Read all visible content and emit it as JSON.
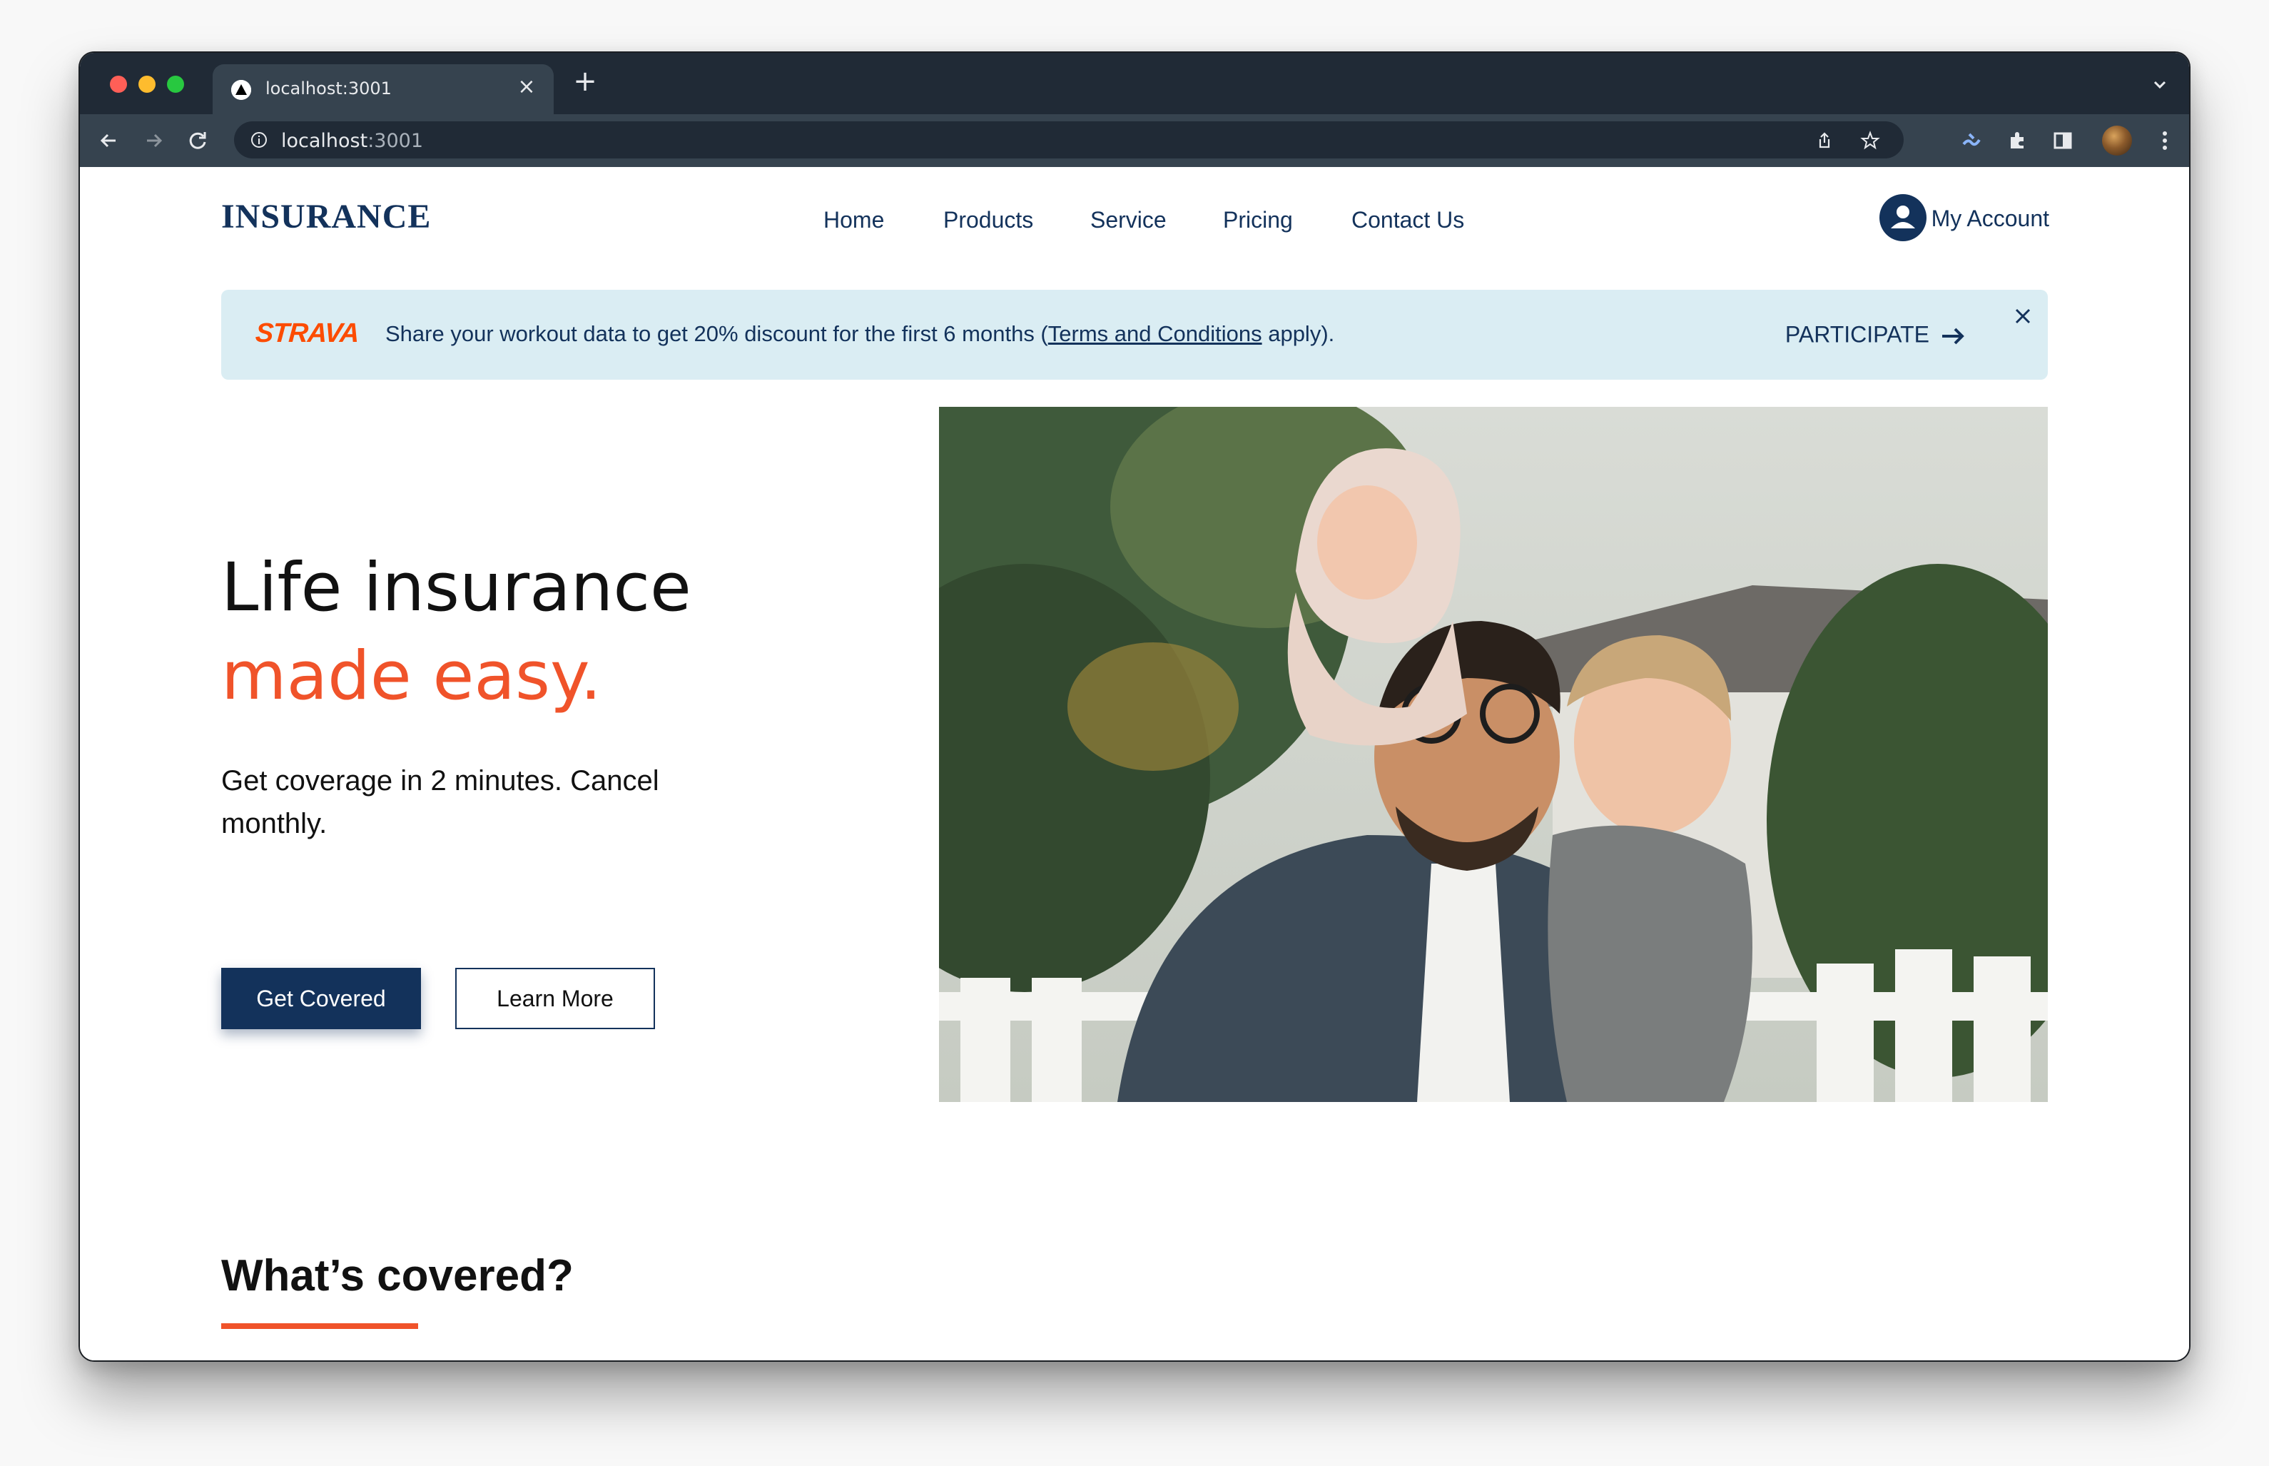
{
  "browser": {
    "tab_title": "localhost:3001",
    "url_host": "localhost",
    "url_port": ":3001"
  },
  "site": {
    "logo": "INSURANCE",
    "nav": [
      "Home",
      "Products",
      "Service",
      "Pricing",
      "Contact Us"
    ],
    "account_label": "My Account"
  },
  "promo": {
    "brand": "STRAVA",
    "text_before": "Share your workout data to get 20% discount for the first 6 months (",
    "terms_link": "Terms and Conditions",
    "text_after": " apply).",
    "cta": "PARTICIPATE"
  },
  "hero": {
    "title_line1": "Life insurance",
    "title_line2": "made easy.",
    "subtitle": "Get coverage in 2 minutes. Cancel monthly.",
    "primary_button": "Get Covered",
    "secondary_button": "Learn More"
  },
  "section": {
    "title": "What’s covered?"
  },
  "colors": {
    "brand_navy": "#13325b",
    "accent_orange": "#f0532a",
    "promo_bg": "#daedf3",
    "strava_orange": "#fc4c02"
  },
  "icons": [
    "next-logo-icon",
    "close-icon",
    "plus-icon",
    "chevron-down-icon",
    "back-icon",
    "forward-icon",
    "reload-icon",
    "info-icon",
    "share-icon",
    "star-icon",
    "extension-icon",
    "puzzle-icon",
    "sidepanel-icon",
    "more-icon",
    "user-icon",
    "arrow-right-icon"
  ]
}
